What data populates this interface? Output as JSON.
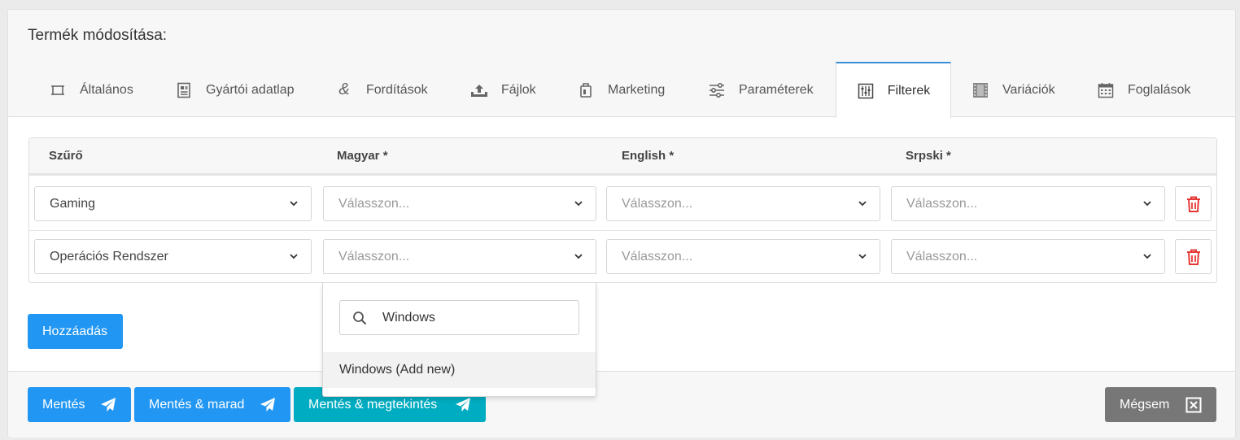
{
  "page": {
    "title": "Termék módosítása:"
  },
  "tabs": [
    {
      "label": "Általános",
      "icon": "crop-frame-icon"
    },
    {
      "label": "Gyártói adatlap",
      "icon": "datasheet-icon"
    },
    {
      "label": "Fordítások",
      "icon": "ampersand-icon"
    },
    {
      "label": "Fájlok",
      "icon": "upload-icon"
    },
    {
      "label": "Marketing",
      "icon": "bag-icon"
    },
    {
      "label": "Paraméterek",
      "icon": "sliders-icon"
    },
    {
      "label": "Filterek",
      "icon": "filter-sliders-icon",
      "active": true
    },
    {
      "label": "Variációk",
      "icon": "film-strip-icon"
    },
    {
      "label": "Foglalások",
      "icon": "calendar-icon"
    }
  ],
  "table": {
    "headers": [
      "Szűrő",
      "Magyar *",
      "English *",
      "Srpski *"
    ],
    "rows": [
      {
        "filter": "Gaming",
        "magyar": "Válasszon...",
        "english": "Válasszon...",
        "srpski": "Válasszon..."
      },
      {
        "filter": "Operációs Rendszer",
        "magyar": "Válasszon...",
        "english": "Válasszon...",
        "srpski": "Válasszon..."
      }
    ]
  },
  "dropdown": {
    "search_value": "Windows",
    "option": "Windows (Add new)"
  },
  "buttons": {
    "add": "Hozzáadás",
    "save": "Mentés",
    "save_stay": "Mentés & marad",
    "save_view": "Mentés & megtekintés",
    "cancel": "Mégsem"
  },
  "colors": {
    "primary": "#2196f3",
    "teal": "#00acc1",
    "gray": "#777777",
    "danger": "#e53935",
    "active_tab_border": "#3b8fd8"
  }
}
